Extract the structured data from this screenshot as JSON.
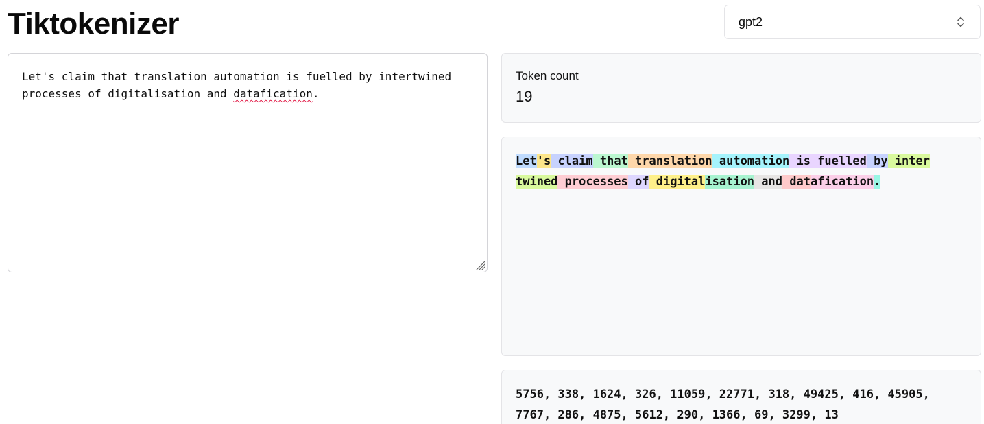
{
  "app": {
    "title": "Tiktokenizer"
  },
  "model_select": {
    "value": "gpt2"
  },
  "input": {
    "text_before_misspelling": "Let's claim that translation automation is fuelled by intertwined processes of digitalisation and ",
    "misspelled_word": "datafication",
    "text_after_misspelling": "."
  },
  "token_count": {
    "label": "Token count",
    "value": "19"
  },
  "tokens": [
    {
      "text": "Let",
      "color": "#bfdbfe"
    },
    {
      "text": "'s",
      "color": "#fde68a"
    },
    {
      "text": " claim",
      "color": "#c7d2fe"
    },
    {
      "text": " that",
      "color": "#bbf7d0"
    },
    {
      "text": " translation",
      "color": "#fed7aa"
    },
    {
      "text": " automation",
      "color": "#a5f3fc"
    },
    {
      "text": " is",
      "color": "#e9d5ff"
    },
    {
      "text": " fuelled",
      "color": "#e9d5ff"
    },
    {
      "text": " by",
      "color": "#c7d2fe"
    },
    {
      "text": " inter",
      "color": "#d9f99d"
    },
    {
      "text": "twined",
      "color": "#d9f99d"
    },
    {
      "text": " processes",
      "color": "#fecdd3"
    },
    {
      "text": " of",
      "color": "#ddd6fe"
    },
    {
      "text": " digital",
      "color": "#fef08a"
    },
    {
      "text": "isation",
      "color": "#a7f3d0"
    },
    {
      "text": " and",
      "color": "#e7e5e4"
    },
    {
      "text": " dat",
      "color": "#fecaca"
    },
    {
      "text": "afication",
      "color": "#fbcfe8"
    },
    {
      "text": ".",
      "color": "#99f6e4"
    }
  ],
  "token_ids": {
    "text": "5756, 338, 1624, 326, 11059, 22771, 318, 49425, 416, 45905, 7767, 286, 4875, 5612, 290, 1366, 69, 3299, 13"
  }
}
